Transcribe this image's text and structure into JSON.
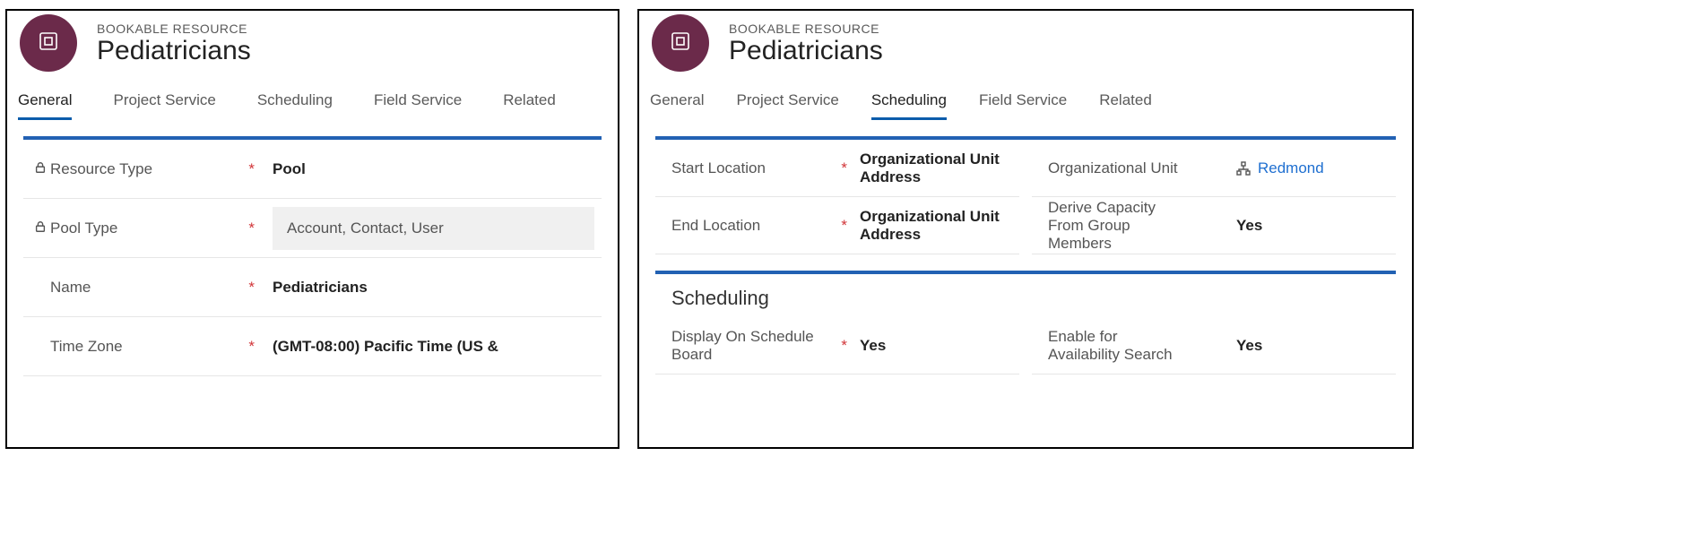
{
  "entityLabel": "BOOKABLE RESOURCE",
  "entityTitle": "Pediatricians",
  "tabs": {
    "general": "General",
    "projectService": "Project Service",
    "scheduling": "Scheduling",
    "fieldService": "Field Service",
    "related": "Related"
  },
  "generalTab": {
    "resourceType": {
      "label": "Resource Type",
      "value": "Pool"
    },
    "poolType": {
      "label": "Pool Type",
      "value": "Account, Contact, User"
    },
    "name": {
      "label": "Name",
      "value": "Pediatricians"
    },
    "timeZone": {
      "label": "Time Zone",
      "value": "(GMT-08:00) Pacific Time (US &"
    }
  },
  "schedulingTab": {
    "startLocation": {
      "label": "Start Location",
      "value": "Organizational Unit Address"
    },
    "endLocation": {
      "label": "End Location",
      "value": "Organizational Unit Address"
    },
    "orgUnit": {
      "label": "Organizational Unit",
      "value": "Redmond"
    },
    "deriveCapacity": {
      "label": "Derive Capacity From Group Members",
      "value": "Yes"
    },
    "sectionTitle": "Scheduling",
    "displayOnBoard": {
      "label": "Display On Schedule Board",
      "value": "Yes"
    },
    "enableAvail": {
      "label": "Enable for Availability Search",
      "value": "Yes"
    }
  }
}
